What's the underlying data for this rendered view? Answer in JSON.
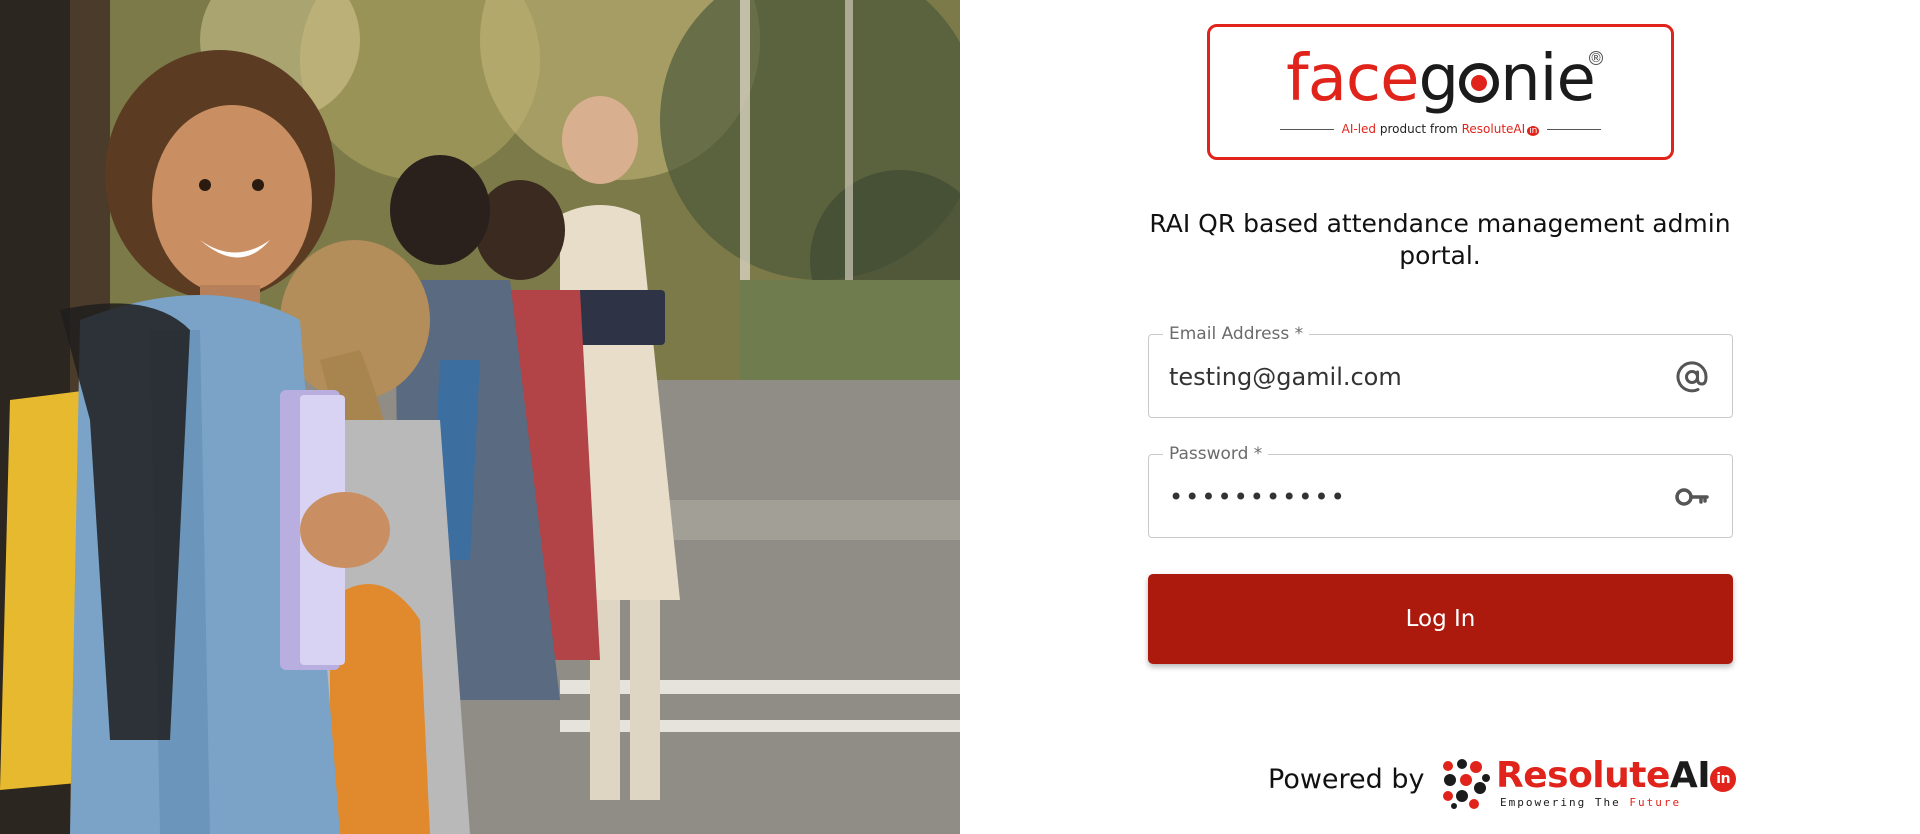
{
  "hero": {
    "image": "students-with-backpacks-photo"
  },
  "brand": {
    "logo_part1": "face",
    "logo_part2": "g",
    "logo_part3": "nie",
    "registered_mark": "®",
    "tagline_prefix": "AI-led",
    "tagline_middle": "product from",
    "tagline_brand": "ResoluteAI",
    "tagline_badge": "in",
    "accent_color": "#e0241b"
  },
  "portal_title": "RAI QR based attendance management admin portal.",
  "form": {
    "email": {
      "label": "Email Address *",
      "value": "testing@gamil.com",
      "icon": "at-sign-icon"
    },
    "password": {
      "label": "Password *",
      "value": "•••••••••••",
      "icon": "key-icon"
    },
    "login_label": "Log In",
    "login_color": "#ac1a0e"
  },
  "footer": {
    "powered_by": "Powered by",
    "company_part1": "Resolute",
    "company_part2": "AI",
    "company_badge": "in",
    "tagline_words": "Empowering  The",
    "tagline_highlight": "Future"
  }
}
